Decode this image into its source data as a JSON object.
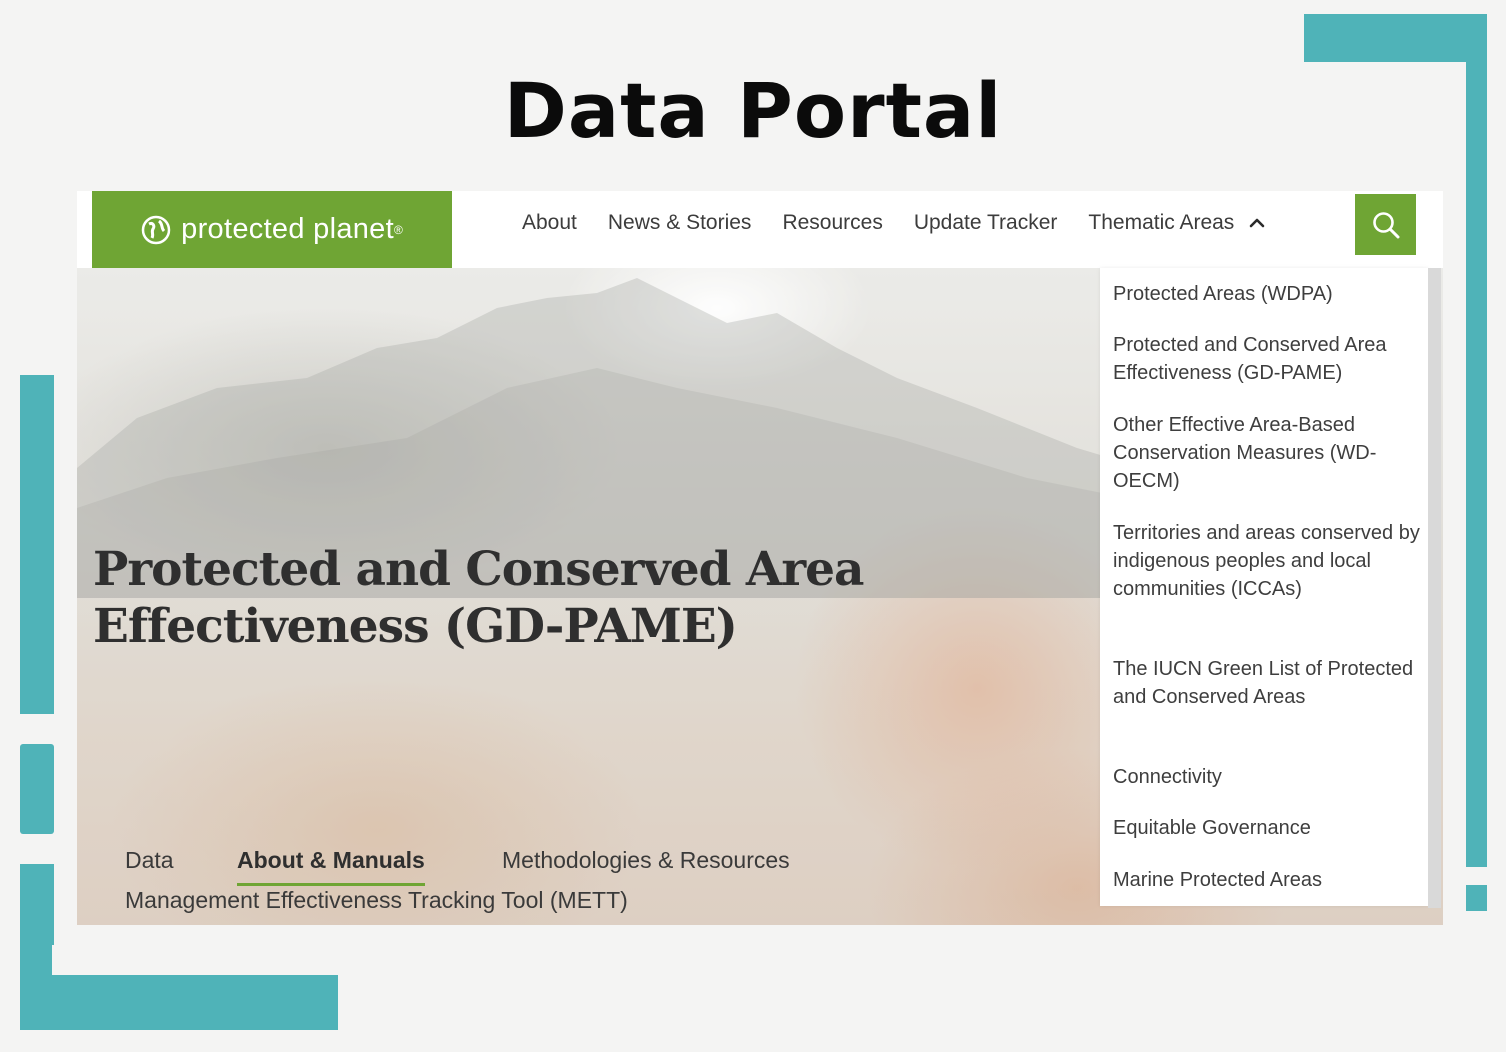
{
  "slide_title": "Data Portal",
  "logo": {
    "text": "protected planet",
    "reg": "®"
  },
  "nav": {
    "items": [
      "About",
      "News & Stories",
      "Resources",
      "Update Tracker",
      "Thematic Areas"
    ]
  },
  "hero": {
    "title_line1": "Protected and Conserved Area",
    "title_line2": "Effectiveness (GD-PAME)"
  },
  "tabs": {
    "data": "Data",
    "about": "About & Manuals",
    "methods": "Methodologies & Resources",
    "mett": "Management Effectiveness Tracking Tool (METT)"
  },
  "dropdown": {
    "items": [
      "Protected Areas (WDPA)",
      "Protected and Conserved Area Effectiveness (GD-PAME)",
      "Other Effective Area-Based Conservation Measures (WD-OECM)",
      "Territories and areas conserved by indigenous peoples and local communities (ICCAs)",
      "The IUCN Green List of Protected and Conserved Areas",
      "Connectivity",
      "Equitable Governance",
      "Marine Protected Areas"
    ]
  },
  "colors": {
    "brand_green": "#6fa534",
    "teal": "#4fb3b8"
  }
}
